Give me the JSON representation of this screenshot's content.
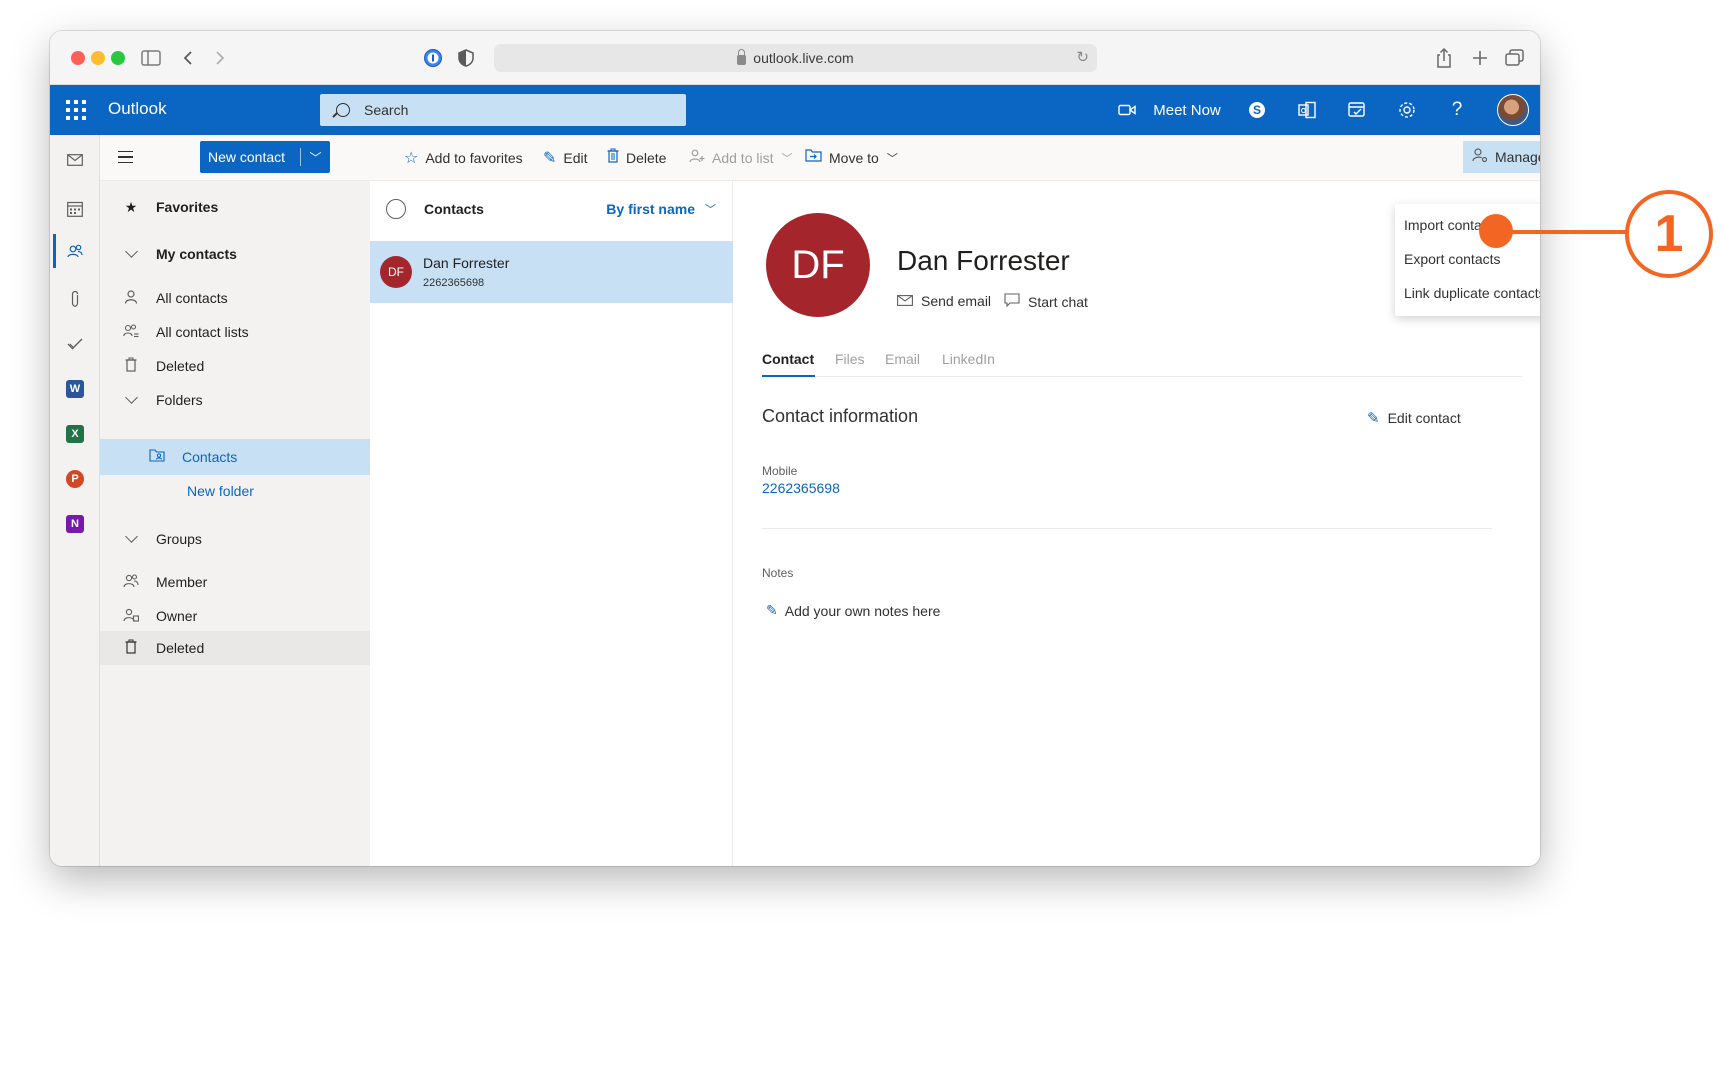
{
  "browser": {
    "url": "outlook.live.com"
  },
  "header": {
    "app_name": "Outlook",
    "search_placeholder": "Search",
    "meet_now_label": "Meet Now",
    "help_label": "?"
  },
  "toolbar": {
    "new_contact_label": "New contact",
    "add_to_favorites_label": "Add to favorites",
    "edit_label": "Edit",
    "delete_label": "Delete",
    "add_to_list_label": "Add to list",
    "move_to_label": "Move to",
    "manage_label": "Manage"
  },
  "manage_menu": {
    "items": [
      "Import contacts",
      "Export contacts",
      "Link duplicate contacts"
    ]
  },
  "folders": {
    "favorites_label": "Favorites",
    "my_contacts_label": "My contacts",
    "all_contacts_label": "All contacts",
    "all_contact_lists_label": "All contact lists",
    "deleted_label": "Deleted",
    "folders_label": "Folders",
    "contacts_folder_label": "Contacts",
    "new_folder_label": "New folder",
    "groups_label": "Groups",
    "member_label": "Member",
    "owner_label": "Owner",
    "groups_deleted_label": "Deleted"
  },
  "contact_list": {
    "header_title": "Contacts",
    "sort_label": "By first name",
    "rows": [
      {
        "initials": "DF",
        "name": "Dan Forrester",
        "phone": "2262365698"
      }
    ]
  },
  "detail": {
    "initials": "DF",
    "name": "Dan Forrester",
    "send_email_label": "Send email",
    "start_chat_label": "Start chat",
    "tabs": [
      "Contact",
      "Files",
      "Email",
      "LinkedIn"
    ],
    "section_title": "Contact information",
    "edit_contact_label": "Edit contact",
    "mobile_label": "Mobile",
    "mobile_value": "2262365698",
    "notes_label": "Notes",
    "notes_placeholder": "Add your own notes here"
  },
  "annotation": {
    "step_number": "1"
  },
  "colors": {
    "brand_blue": "#0a66c2",
    "selection_blue": "#c7e0f4",
    "avatar_red": "#a4262c",
    "callout_orange": "#f26522"
  }
}
